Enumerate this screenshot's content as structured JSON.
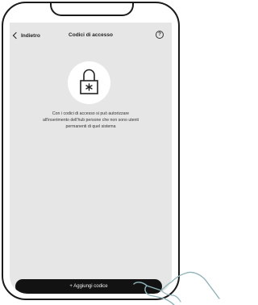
{
  "header": {
    "back_label": "Indietro",
    "title": "Codici di accesso",
    "help_glyph": "?"
  },
  "main": {
    "lock_icon": "padlock-asterisk-icon",
    "description": "Con i codici di accesso si può autorizzare\nall'inserimento dell'hub persone che non sono utenti\npermanenti di quel sistema"
  },
  "footer": {
    "add_button_label": "+ Aggiungi codice"
  },
  "colors": {
    "screen_bg": "#e6e6e6",
    "button_bg": "#121212",
    "button_text": "#f2f2f2",
    "outline": "#1a1a1a"
  },
  "overlay": {
    "pointer_icon": "hand-tap-icon"
  }
}
